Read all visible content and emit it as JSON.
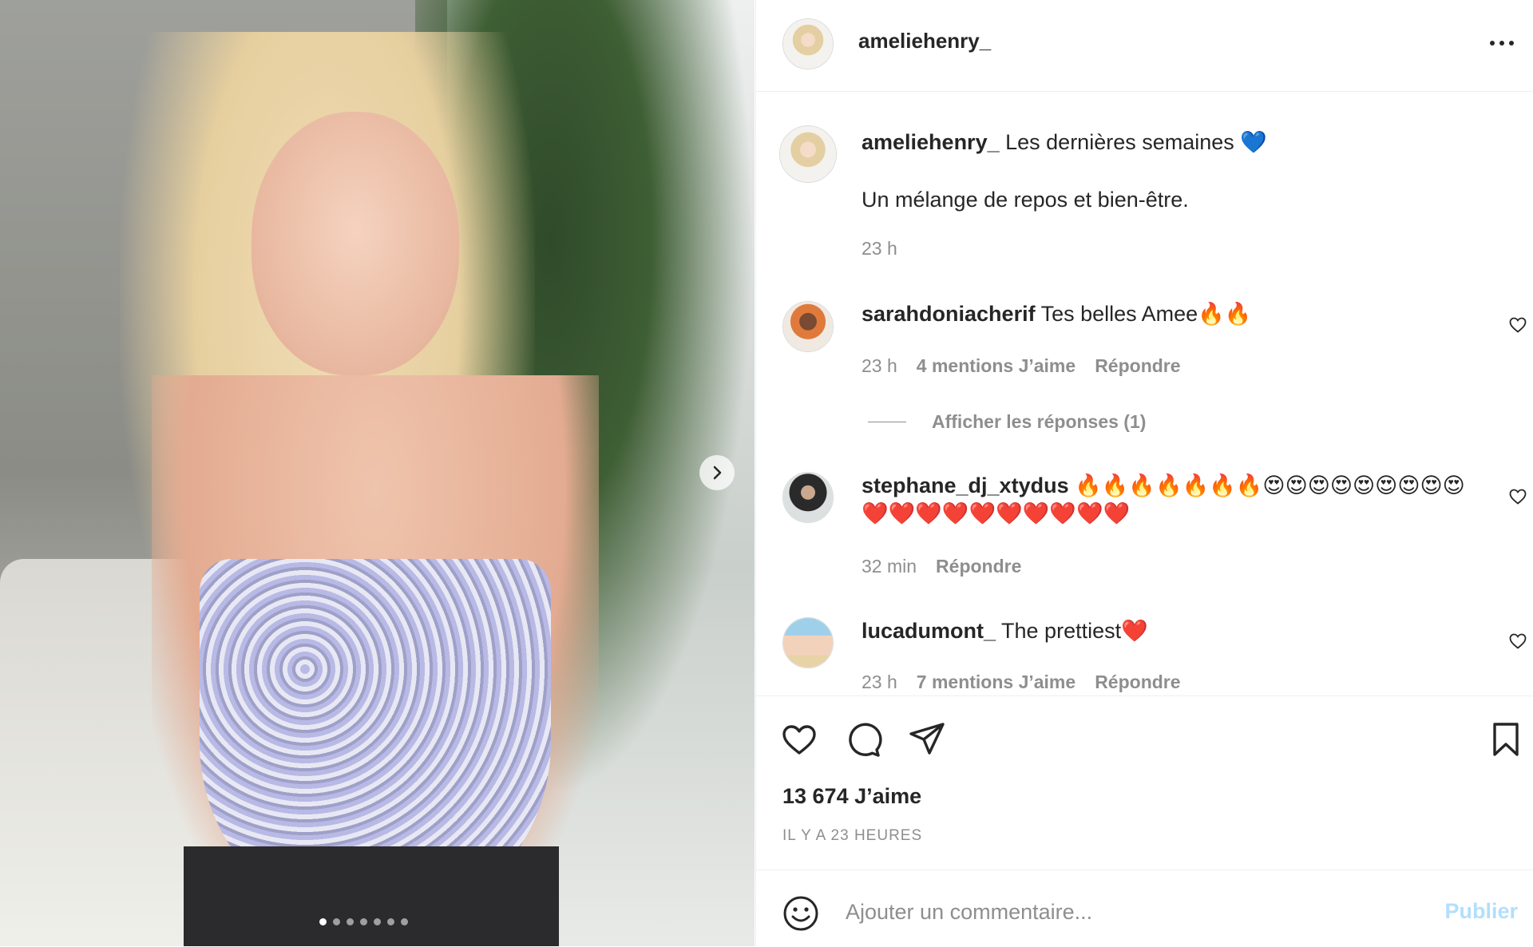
{
  "post": {
    "username": "ameliehenry_",
    "caption_line1": "Les dernières semaines 💙",
    "caption_line2": "Un mélange de repos et bien-être.",
    "caption_time": "23 h",
    "likes": "13 674 J’aime",
    "posted": "IL Y A 23 HEURES",
    "carousel_count": 7,
    "carousel_active": 1
  },
  "comments": [
    {
      "username": "sarahdoniacherif",
      "text": "Tes belles Amee🔥🔥",
      "time": "23 h",
      "likes": "4 mentions J’aime",
      "reply": "Répondre",
      "view_replies": "Afficher les réponses (1)"
    },
    {
      "username": "stephane_dj_xtydus",
      "text": "🔥🔥🔥🔥🔥🔥🔥😍😍😍😍😍😍😍😍😍",
      "text2": "❤️❤️❤️❤️❤️❤️❤️❤️❤️❤️",
      "time": "32 min",
      "reply": "Répondre"
    },
    {
      "username": "lucadumont_",
      "text": "The prettiest❤️",
      "time": "23 h",
      "likes": "7 mentions J’aime",
      "reply": "Répondre"
    }
  ],
  "add_comment": {
    "placeholder": "Ajouter un commentaire...",
    "publish": "Publier"
  },
  "icons": {
    "more": "more-horizontal-icon",
    "like": "heart-icon",
    "comment": "comment-bubble-icon",
    "share": "paper-plane-icon",
    "save": "bookmark-icon",
    "emoji": "smiley-icon",
    "next": "chevron-right-icon"
  },
  "colors": {
    "text": "#262626",
    "muted": "#8e8e8e",
    "border": "#efefef",
    "publish_disabled": "#b2dffc"
  }
}
